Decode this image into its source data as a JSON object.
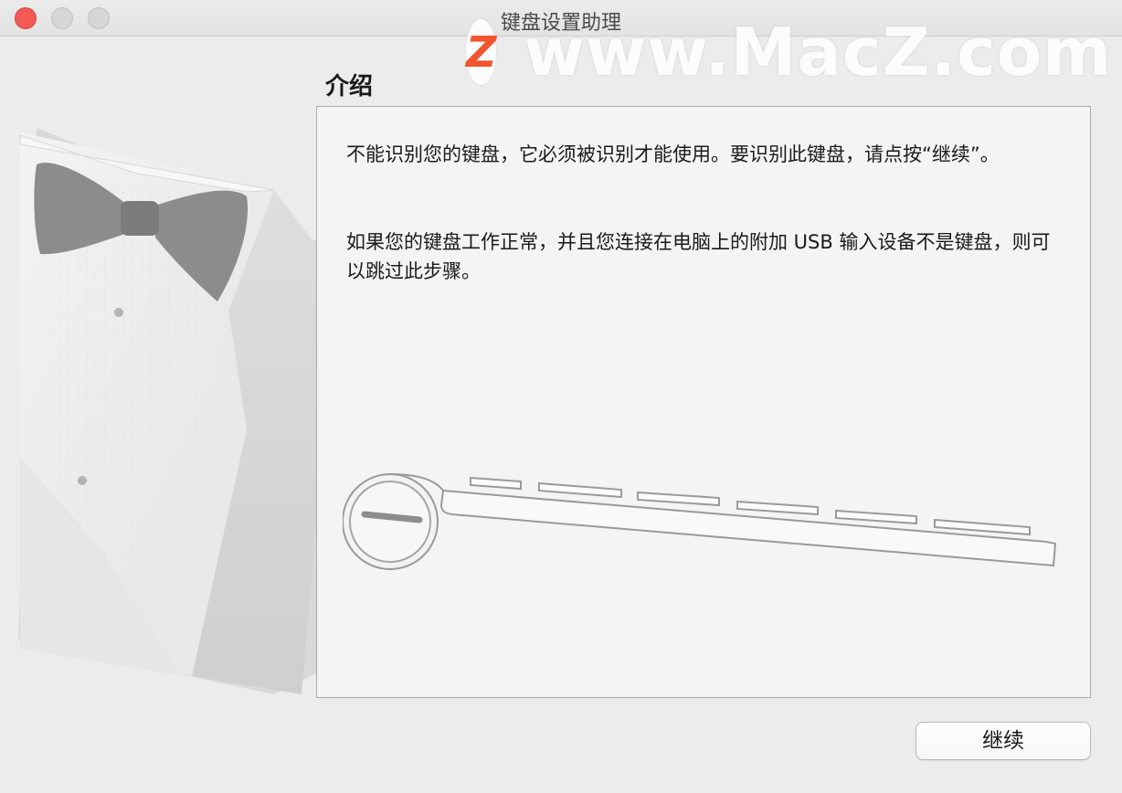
{
  "window": {
    "title": "键盘设置助理"
  },
  "watermark": {
    "logo_letter": "Z",
    "text": "www.MacZ.com"
  },
  "section": {
    "title": "介绍"
  },
  "content": {
    "paragraph1": "不能识别您的键盘，它必须被识别才能使用。要识别此键盘，请点按“继续”。",
    "paragraph2": "如果您的键盘工作正常，并且您连接在电脑上的附加 USB 输入设备不是键盘，则可以跳过此步骤。"
  },
  "buttons": {
    "continue_label": "继续"
  },
  "icons": {
    "illustration": "tuxedo-assistant-illustration",
    "keyboard": "keyboard-side-view-icon"
  },
  "colors": {
    "close": "#f25a55",
    "window_bg": "#ececec",
    "watermark_accent": "#f2542d"
  }
}
